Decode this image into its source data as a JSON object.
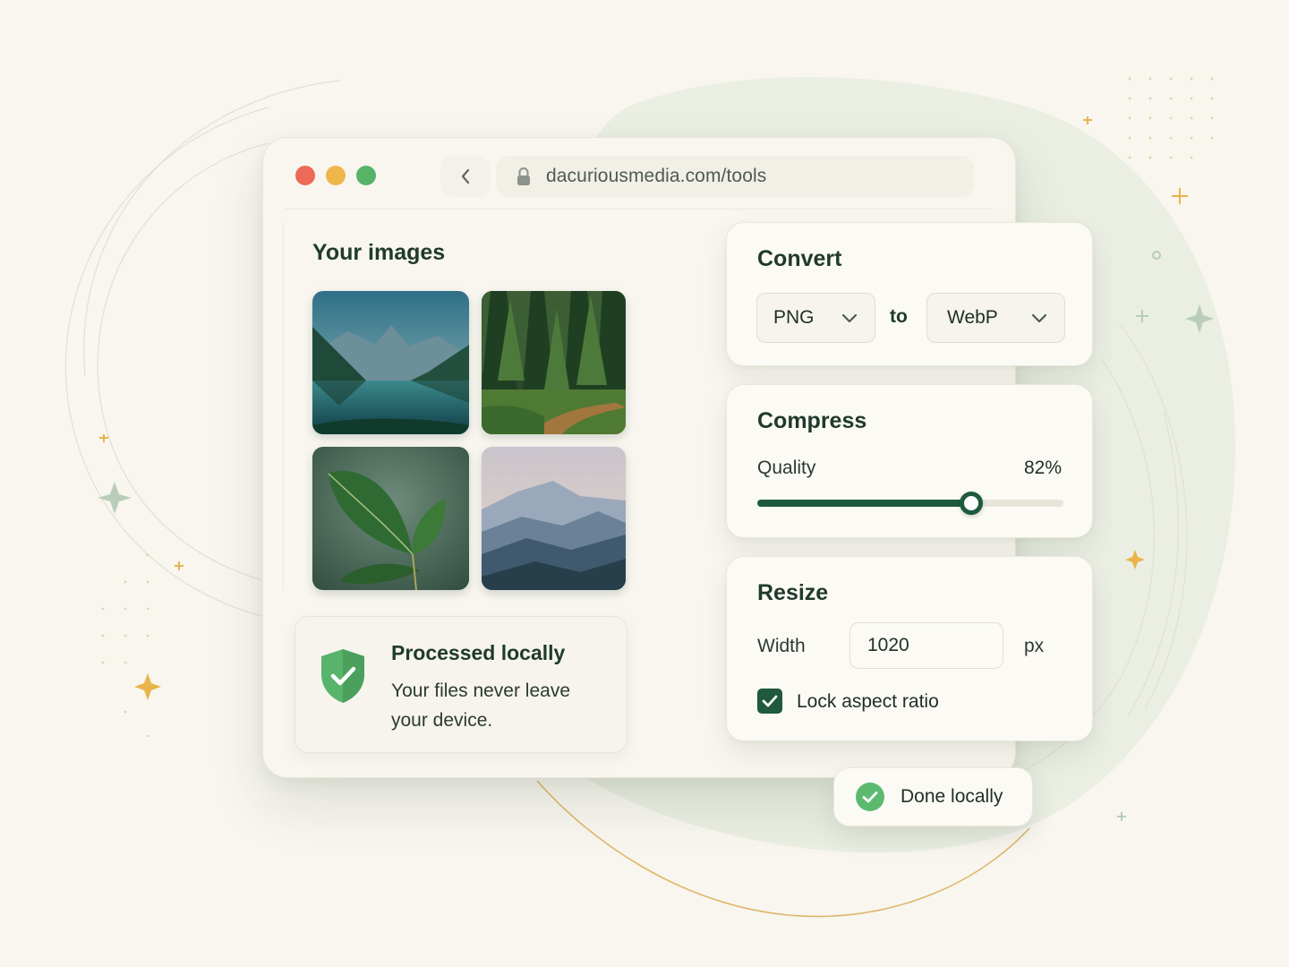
{
  "browser": {
    "url": "dacuriousmedia.com/tools"
  },
  "gallery": {
    "title": "Your images",
    "images": [
      {
        "name": "mountain-lake"
      },
      {
        "name": "forest-path"
      },
      {
        "name": "green-leaves"
      },
      {
        "name": "misty-mountains"
      }
    ]
  },
  "privacy_card": {
    "title": "Processed locally",
    "text": "Your files never leave your device."
  },
  "convert": {
    "title": "Convert",
    "from_format": "PNG",
    "to_label": "to",
    "to_format": "WebP"
  },
  "compress": {
    "title": "Compress",
    "quality_label": "Quality",
    "quality_value": "82%",
    "quality_level": 0.7
  },
  "resize": {
    "title": "Resize",
    "width_label": "Width",
    "width_value": "1020",
    "unit": "px",
    "lock_label": "Lock aspect ratio",
    "lock_checked": true
  },
  "toast": {
    "text": "Done locally"
  },
  "colors": {
    "accent": "#1f5a3e",
    "success": "#56b368",
    "background": "#f8f6ef"
  }
}
